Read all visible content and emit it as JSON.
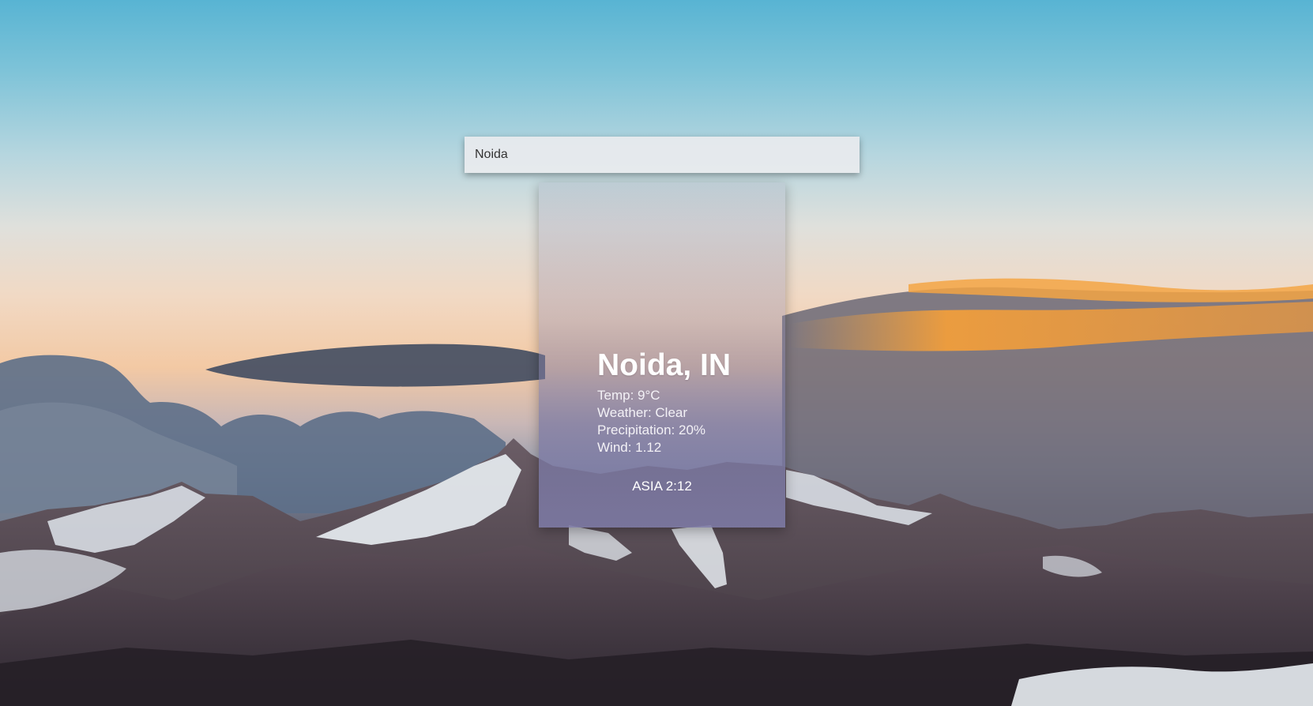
{
  "search": {
    "value": "Noida"
  },
  "weather": {
    "city": "Noida, IN",
    "temp": "Temp: 9°C",
    "condition": "Weather: Clear",
    "precipitation": "Precipitation: 20%",
    "wind": "Wind: 1.12",
    "timezone": "ASIA 2:12"
  },
  "colors": {
    "card_tint": "#7d7aa5",
    "text": "#ffffff",
    "input_bg": "#e8ebee"
  }
}
